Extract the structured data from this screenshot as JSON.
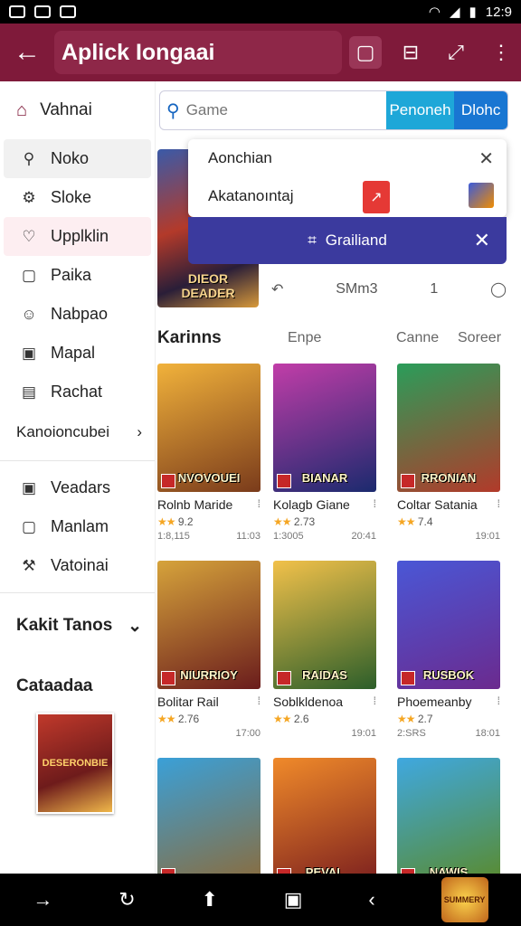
{
  "status_bar": {
    "time": "12:9"
  },
  "app_bar": {
    "title": "Aplick Iongaai"
  },
  "sidebar": {
    "header": "Vahnai",
    "items": [
      {
        "label": "Noko",
        "icon": "search-icon"
      },
      {
        "label": "Sloke",
        "icon": "settings-icon"
      },
      {
        "label": "Upplklin",
        "icon": "heart-icon"
      },
      {
        "label": "Paika",
        "icon": "square-icon"
      },
      {
        "label": "Nabpao",
        "icon": "user-icon"
      },
      {
        "label": "Mapal",
        "icon": "box-icon"
      },
      {
        "label": "Rachat",
        "icon": "chart-icon"
      }
    ],
    "group_label": "Kanoioncubei",
    "items2": [
      {
        "label": "Veadars",
        "icon": "box-icon"
      },
      {
        "label": "Manlam",
        "icon": "square-icon"
      },
      {
        "label": "Vatoinai",
        "icon": "wrench-icon"
      }
    ],
    "section": "Kakit Tanos",
    "catalog_label": "Cataadaa",
    "catalog_thumb_text": "DESERONBIE"
  },
  "search": {
    "placeholder": "Game",
    "button1": "Penoneh",
    "button2": "Dlohc"
  },
  "hero": {
    "image_text": "DIEOR DEADER"
  },
  "dropdown": {
    "row1": "Aonchian",
    "row2": "Akatanoıntaj"
  },
  "snackbar": {
    "label": "Grailiand"
  },
  "toolrow": {
    "center_text": "SMm3",
    "count": "1"
  },
  "section": {
    "title": "Karinns",
    "tab1": "Enpe",
    "tab2": "Canne",
    "tab3": "Soreer"
  },
  "games": [
    {
      "title": "Rolnb Maride",
      "rating": "9.2",
      "meta_left": "1:8,115",
      "meta_right": "11:03",
      "art_text": "NVOVOUEI",
      "c1": "#f1b23b",
      "c2": "#7a3b1b"
    },
    {
      "title": "Kolagb Giane",
      "rating": "2.73",
      "meta_left": "1:3005",
      "meta_right": "20:41",
      "art_text": "BIANAR",
      "c1": "#c13da8",
      "c2": "#1b2a6e"
    },
    {
      "title": "Coltar Satania",
      "rating": "7.4",
      "meta_left": "",
      "meta_right": "19:01",
      "art_text": "RRONIAN",
      "c1": "#2a9d5a",
      "c2": "#b23a2a"
    },
    {
      "title": "Bolitar Rail",
      "rating": "2.76",
      "meta_left": "",
      "meta_right": "17:00",
      "art_text": "NIURRIOY",
      "c1": "#d6a33b",
      "c2": "#6a1c1c"
    },
    {
      "title": "Soblkldenoa",
      "rating": "2.6",
      "meta_left": "",
      "meta_right": "19:01",
      "art_text": "RAIDAS",
      "c1": "#f2c14a",
      "c2": "#2c5e2a"
    },
    {
      "title": "Phoemeanby",
      "rating": "2.7",
      "meta_left": "2:SRS",
      "meta_right": "18:01",
      "art_text": "RUSBOK",
      "c1": "#4a57d6",
      "c2": "#6b2a8e"
    },
    {
      "title": "",
      "rating": "",
      "meta_left": "",
      "meta_right": "",
      "art_text": "",
      "c1": "#3aa0d8",
      "c2": "#8c6b3a"
    },
    {
      "title": "",
      "rating": "",
      "meta_left": "",
      "meta_right": "",
      "art_text": "PEVAL",
      "c1": "#f08a2a",
      "c2": "#7a1e1e"
    },
    {
      "title": "",
      "rating": "",
      "meta_left": "",
      "meta_right": "",
      "art_text": "NAWIS",
      "c1": "#3fa8e0",
      "c2": "#5a8a2a"
    }
  ],
  "nav_corner": "SUMMERY",
  "colors": {
    "accent": "#7f1a3a",
    "search_btn1": "#1ea7d8",
    "search_btn2": "#1976d2",
    "snackbar": "#3b3a9e"
  }
}
